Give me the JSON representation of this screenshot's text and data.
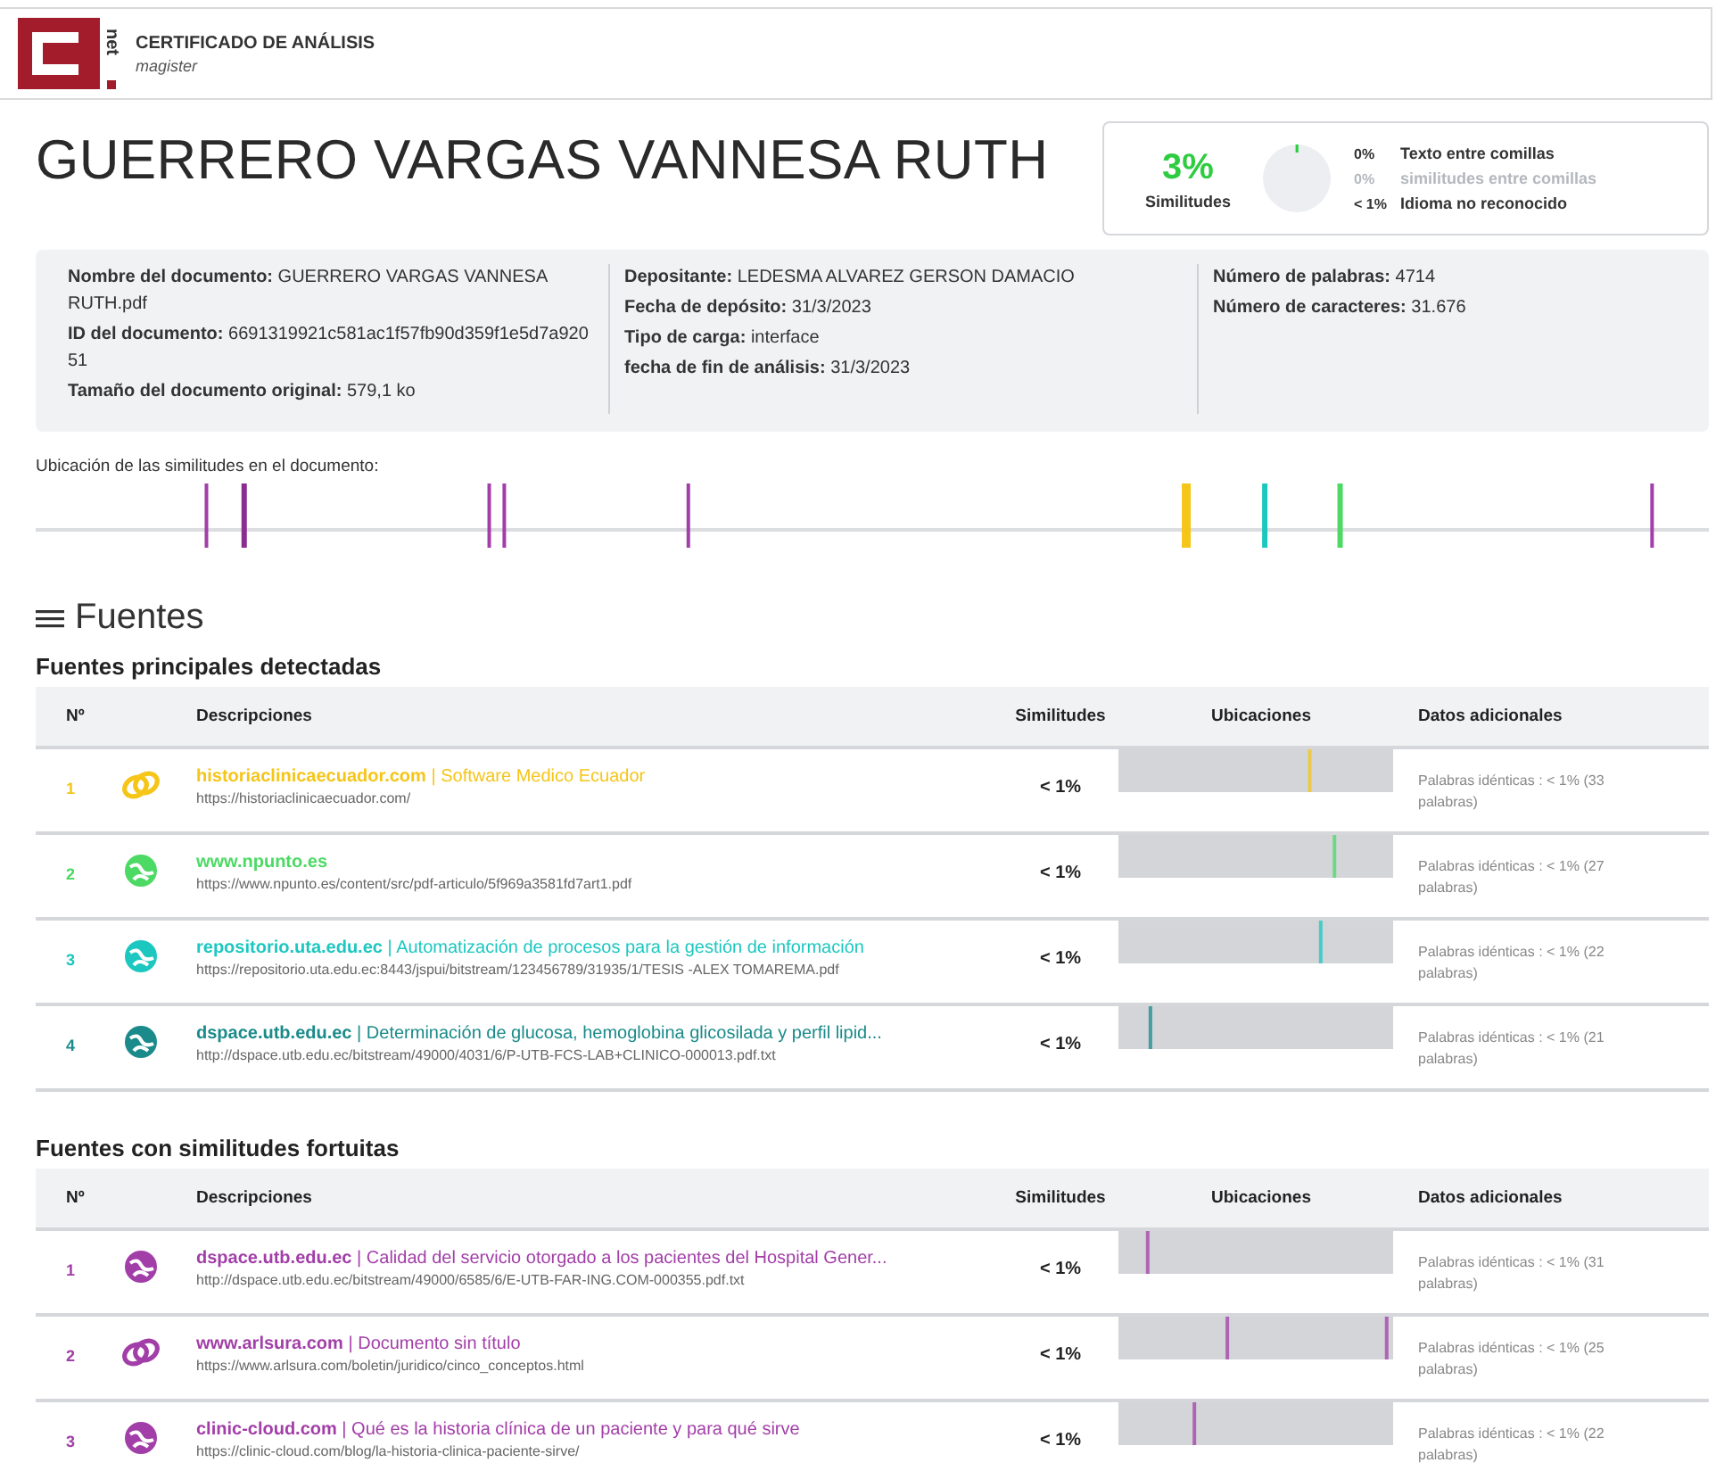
{
  "header": {
    "logo_text": "net",
    "title": "CERTIFICADO DE ANÁLISIS",
    "subtitle": "magister"
  },
  "document_title": "GUERRERO VARGAS VANNESA RUTH",
  "summary": {
    "percent": "3%",
    "label": "Similitudes",
    "items": [
      {
        "value": "0%",
        "label": "Texto entre comillas",
        "kind": "dark"
      },
      {
        "value": "0%",
        "label": "similitudes entre comillas",
        "kind": "muted"
      },
      {
        "value": "< 1%",
        "label": "Idioma no reconocido",
        "kind": "dark"
      }
    ]
  },
  "info": [
    [
      {
        "label": "Nombre del documento:",
        "value": "GUERRERO VARGAS VANNESA RUTH.pdf"
      },
      {
        "label": "ID del documento:",
        "value": "6691319921c581ac1f57fb90d359f1e5d7a92051"
      },
      {
        "label": "Tamaño del documento original:",
        "value": "579,1 ko"
      }
    ],
    [
      {
        "label": "Depositante:",
        "value": "LEDESMA ALVAREZ GERSON DAMACIO"
      },
      {
        "label": "Fecha de depósito:",
        "value": "31/3/2023"
      },
      {
        "label": "Tipo de carga:",
        "value": "interface"
      },
      {
        "label": "fecha de fin de análisis:",
        "value": "31/3/2023"
      }
    ],
    [
      {
        "label": "Número de palabras:",
        "value": "4714"
      },
      {
        "label": "Número de caracteres:",
        "value": "31.676"
      }
    ]
  ],
  "location_label": "Ubicación de las similitudes en el documento:",
  "sources_heading": "Fuentes",
  "sections": [
    {
      "title": "Fuentes principales detectadas",
      "columns": [
        "Nº",
        "Descripciones",
        "Similitudes",
        "Ubicaciones",
        "Datos adicionales"
      ],
      "rows": [
        {
          "number": "1",
          "kind": "link",
          "color": "#f5c518",
          "description": "**historiaclinicaecuador.com** | Software Medico Ecuador",
          "url": "https://historiaclinicaecuador.com/",
          "similarity": "< 1%",
          "details": "Palabras idénticas : < 1% (33 palabras)"
        },
        {
          "number": "2",
          "kind": "globe",
          "color": "#4cd964",
          "description": "**www.npunto.es**",
          "url": "https://www.npunto.es/content/src/pdf-articulo/5f969a3581fd7art1.pdf",
          "similarity": "< 1%",
          "details": "Palabras idénticas : < 1% (27 palabras)"
        },
        {
          "number": "3",
          "kind": "globe",
          "color": "#1cc7c0",
          "description": "**repositorio.uta.edu.ec** | Automatización de procesos para la gestión de información",
          "url": "https://repositorio.uta.edu.ec:8443/jspui/bitstream/123456789/31935/1/TESIS -ALEX TOMAREMA.pdf",
          "similarity": "< 1%",
          "details": "Palabras idénticas : < 1% (22 palabras)"
        },
        {
          "number": "4",
          "kind": "globe",
          "color": "#1a8a8a",
          "description": "**dspace.utb.edu.ec** | Determinación de glucosa, hemoglobina glicosilada y perfil lipid...",
          "url": "http://dspace.utb.edu.ec/bitstream/49000/4031/6/P-UTB-FCS-LAB+CLINICO-000013.pdf.txt",
          "similarity": "< 1%",
          "details": "Palabras idénticas : < 1% (21 palabras)"
        }
      ]
    },
    {
      "title": "Fuentes con similitudes fortuitas",
      "columns": [
        "Nº",
        "Descripciones",
        "Similitudes",
        "Ubicaciones",
        "Datos adicionales"
      ],
      "rows": [
        {
          "number": "1",
          "kind": "globe",
          "color": "#a23ea8",
          "description": "**dspace.utb.edu.ec** | Calidad del servicio otorgado a los pacientes del Hospital Gener...",
          "url": "http://dspace.utb.edu.ec/bitstream/49000/6585/6/E-UTB-FAR-ING.COM-000355.pdf.txt",
          "similarity": "< 1%",
          "details": "Palabras idénticas : < 1% (31 palabras)"
        },
        {
          "number": "2",
          "kind": "link",
          "color": "#a23ea8",
          "description": "**www.arlsura.com** | Documento sin título",
          "url": "https://www.arlsura.com/boletin/juridico/cinco_conceptos.html",
          "similarity": "< 1%",
          "details": "Palabras idénticas : < 1% (25 palabras)"
        },
        {
          "number": "3",
          "kind": "globe",
          "color": "#a23ea8",
          "description": "**clinic-cloud.com** | Qué es la historia clínica de un paciente y para qué sirve",
          "url": "https://clinic-cloud.com/blog/la-historia-clinica-paciente-sirve/",
          "similarity": "< 1%",
          "details": "Palabras idénticas : < 1% (22 palabras)"
        }
      ]
    }
  ]
}
